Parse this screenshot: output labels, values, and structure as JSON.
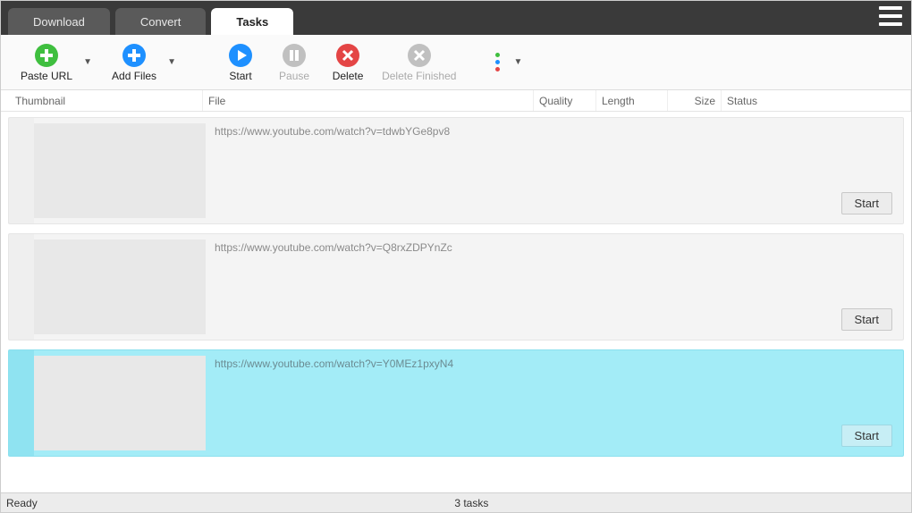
{
  "tabs": {
    "download": "Download",
    "convert": "Convert",
    "tasks": "Tasks"
  },
  "toolbar": {
    "paste_url": "Paste URL",
    "add_files": "Add Files",
    "start": "Start",
    "pause": "Pause",
    "delete": "Delete",
    "delete_finished": "Delete Finished"
  },
  "columns": {
    "thumbnail": "Thumbnail",
    "file": "File",
    "quality": "Quality",
    "length": "Length",
    "size": "Size",
    "status": "Status"
  },
  "tasks": [
    {
      "url": "https://www.youtube.com/watch?v=tdwbYGe8pv8",
      "start_label": "Start",
      "selected": false
    },
    {
      "url": "https://www.youtube.com/watch?v=Q8rxZDPYnZc",
      "start_label": "Start",
      "selected": false
    },
    {
      "url": "https://www.youtube.com/watch?v=Y0MEz1pxyN4",
      "start_label": "Start",
      "selected": true
    }
  ],
  "status": {
    "ready": "Ready",
    "count": "3 tasks"
  },
  "colors": {
    "green": "#3fbf3f",
    "blue": "#1e90ff",
    "grey": "#c0c0c0",
    "red": "#e44545",
    "orange": "#f0a020"
  }
}
